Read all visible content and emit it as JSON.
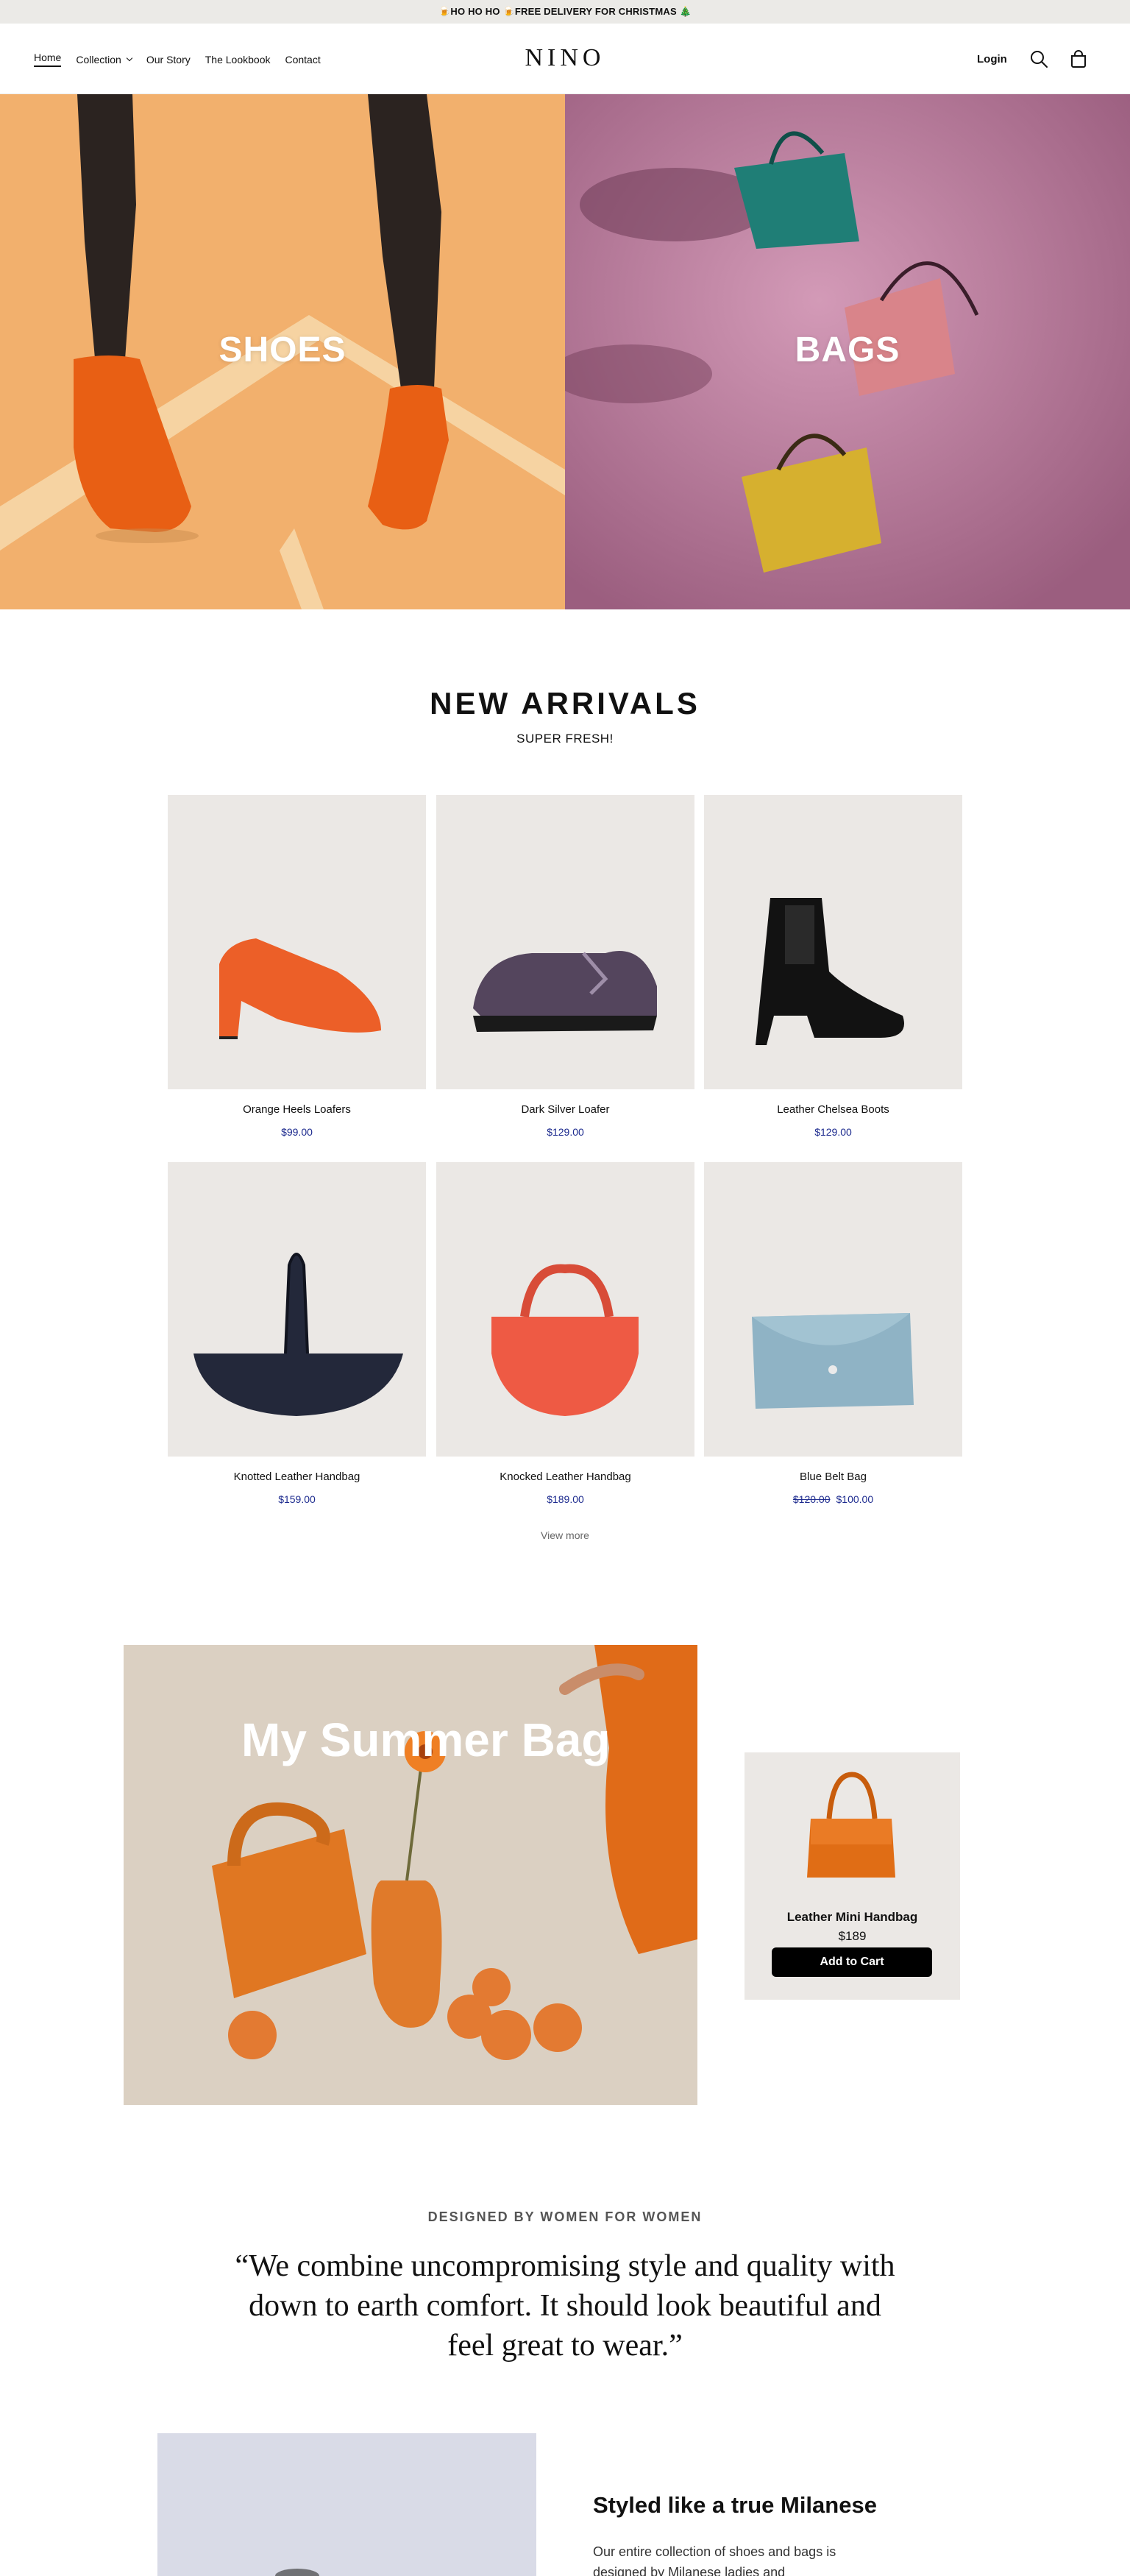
{
  "announcement": {
    "text": "🍺HO HO HO 🍺FREE DELIVERY FOR CHRISTMAS 🎄"
  },
  "header": {
    "nav": [
      {
        "label": "Home",
        "active": true
      },
      {
        "label": "Collection",
        "has_dropdown": true
      },
      {
        "label": "Our Story"
      },
      {
        "label": "The Lookbook"
      },
      {
        "label": "Contact"
      }
    ],
    "logo": "NINO",
    "login": "Login",
    "icons": [
      "search-icon",
      "cart-icon"
    ]
  },
  "hero": {
    "left_title": "SHOES",
    "right_title": "BAGS"
  },
  "new_arrivals": {
    "title": "NEW ARRIVALS",
    "subtitle": "SUPER FRESH!",
    "products": [
      {
        "name": "Orange Heels Loafers",
        "price": "$99.00"
      },
      {
        "name": "Dark Silver Loafer",
        "price": "$129.00"
      },
      {
        "name": "Leather Chelsea Boots",
        "price": "$129.00"
      },
      {
        "name": "Knotted Leather Handbag",
        "price": "$159.00"
      },
      {
        "name": "Knocked Leather Handbag",
        "price": "$189.00"
      },
      {
        "name": "Blue Belt Bag",
        "old_price": "$120.00",
        "price": "$100.00"
      }
    ],
    "view_more": "View more"
  },
  "summer": {
    "title": "My Summer Bag",
    "product": {
      "name": "Leather Mini Handbag",
      "price": "$189",
      "button": "Add to Cart"
    }
  },
  "story": {
    "eyebrow": "DESIGNED BY WOMEN FOR WOMEN",
    "quote": "“We combine uncompromising style and quality with down to earth comfort. It should look beautiful and feel great to wear.”"
  },
  "milanese": {
    "title": "Styled like a true Milanese",
    "text": "Our entire collection of shoes and bags is designed by Milanese ladies and"
  },
  "colors": {
    "accent_price": "#1c2a8e",
    "announcement_bg": "#ebeae7",
    "card_bg": "#ebe8e5",
    "button_bg": "#000000"
  }
}
